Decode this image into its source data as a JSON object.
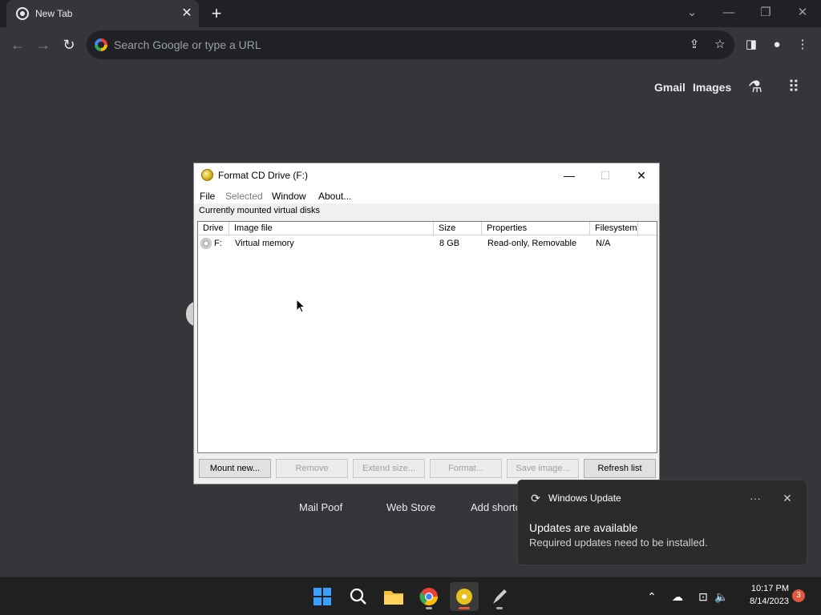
{
  "browser": {
    "tab": {
      "title": "New Tab",
      "close": "✕"
    },
    "new_tab": "+",
    "window_controls": {
      "dropdown": "⌄",
      "minimize": "—",
      "restore": "❐",
      "close": "✕"
    },
    "omnibox_placeholder": "Search Google or type a URL",
    "ntp_links": {
      "gmail": "Gmail",
      "images": "Images"
    },
    "shortcuts": [
      "Mail Poof",
      "Web Store",
      "Add shortc"
    ]
  },
  "dialog": {
    "title": "Format CD Drive (F:)",
    "menu": [
      "File",
      "Selected",
      "Window",
      "About..."
    ],
    "group_label": "Currently mounted virtual disks",
    "columns": [
      "Drive",
      "Image file",
      "Size",
      "Properties",
      "Filesystem"
    ],
    "rows": [
      {
        "drive": "F:",
        "image_file": "Virtual memory",
        "size": "8 GB",
        "properties": "Read-only, Removable",
        "filesystem": "N/A"
      }
    ],
    "buttons": [
      "Mount new...",
      "Remove",
      "Extend size...",
      "Format...",
      "Save image...",
      "Refresh list"
    ]
  },
  "toast": {
    "app": "Windows Update",
    "title": "Updates are available",
    "body": "Required updates need to be installed."
  },
  "taskbar": {
    "time": "10:17 PM",
    "date": "8/14/2023",
    "badge": "3"
  }
}
